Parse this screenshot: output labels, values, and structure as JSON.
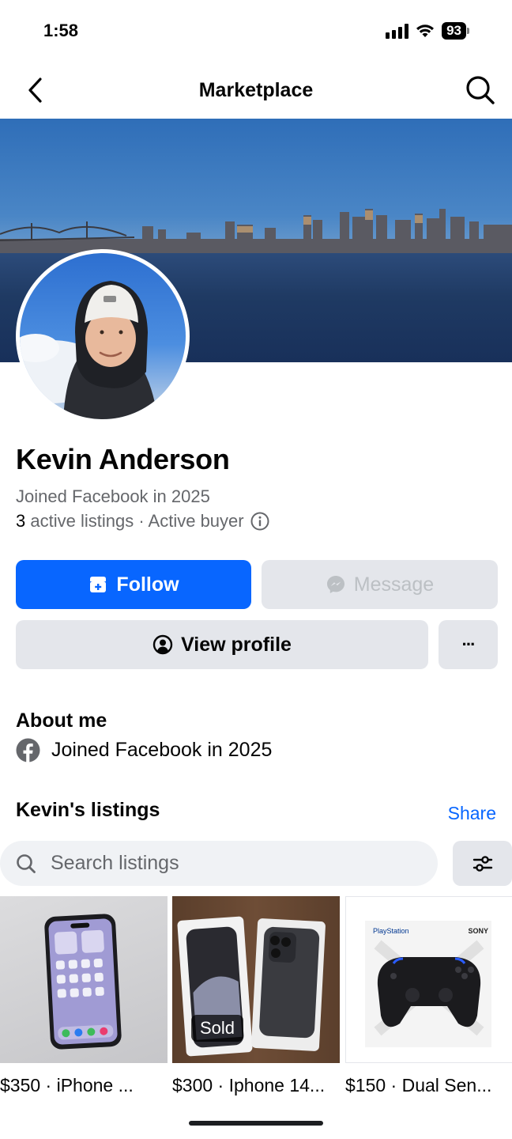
{
  "status_bar": {
    "time": "1:58",
    "battery": "93"
  },
  "nav": {
    "title": "Marketplace",
    "back_icon": "chevron-left-icon",
    "search_icon": "search-icon"
  },
  "profile": {
    "name": "Kevin Anderson",
    "joined": "Joined Facebook in 2025",
    "active_count": "3",
    "active_text": "active listings · Active buyer"
  },
  "actions": {
    "follow_label": "Follow",
    "message_label": "Message",
    "view_profile_label": "View profile",
    "more_label": "···"
  },
  "about": {
    "title": "About me",
    "joined": "Joined Facebook in 2025"
  },
  "listings": {
    "title": "Kevin's listings",
    "share_label": "Share",
    "search_placeholder": "Search listings",
    "items": [
      {
        "caption": "$350 · iPhone ...",
        "sold": false
      },
      {
        "caption": "$300 · Iphone 14...",
        "sold": true,
        "badge": "Sold"
      },
      {
        "caption": "$150 · Dual Sen...",
        "sold": false
      }
    ],
    "brand_labels": {
      "playstation": "PlayStation",
      "sony": "SONY"
    }
  },
  "colors": {
    "accent": "#0866ff",
    "button_gray": "#e4e6eb",
    "muted_text": "#65676b"
  }
}
